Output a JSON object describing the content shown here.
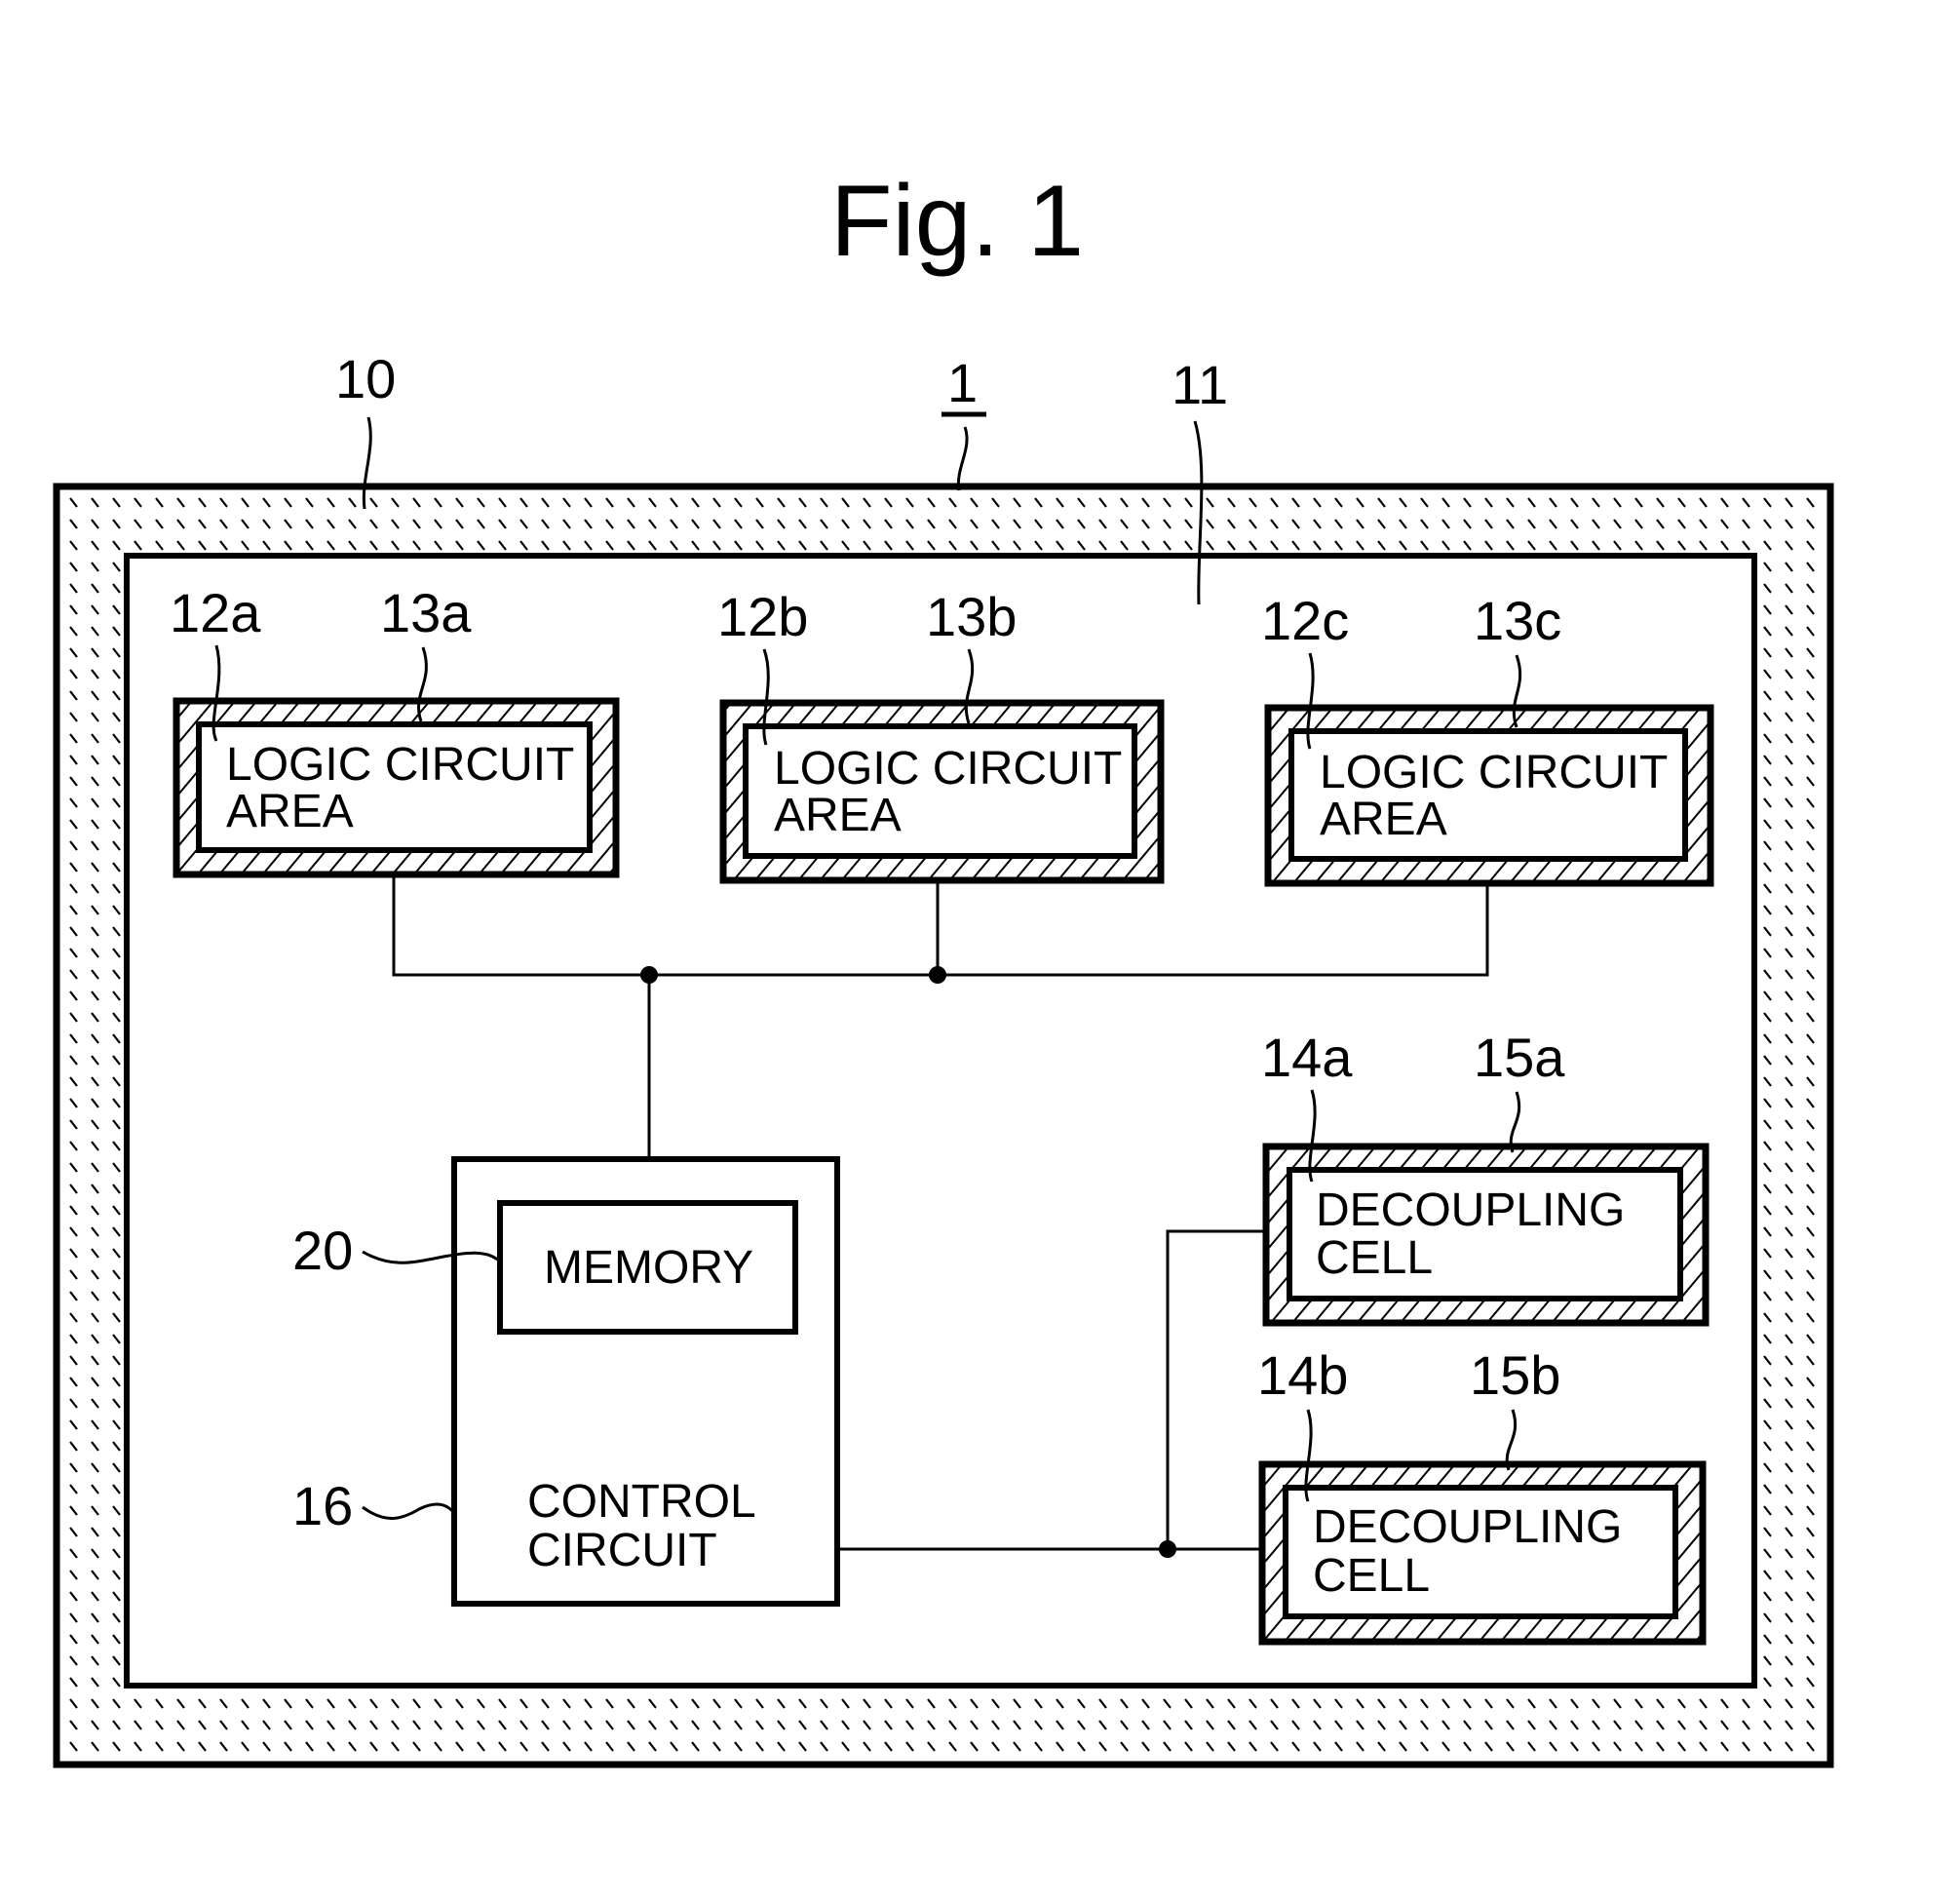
{
  "figure": {
    "title": "Fig. 1",
    "device_ref": "1",
    "chip_ref": "10",
    "core_ref": "11"
  },
  "logic_areas": [
    {
      "area_ref": "12a",
      "ring_ref": "13a",
      "line1": "LOGIC CIRCUIT",
      "line2": "AREA"
    },
    {
      "area_ref": "12b",
      "ring_ref": "13b",
      "line1": "LOGIC CIRCUIT",
      "line2": "AREA"
    },
    {
      "area_ref": "12c",
      "ring_ref": "13c",
      "line1": "LOGIC CIRCUIT",
      "line2": "AREA"
    }
  ],
  "decoupling_cells": [
    {
      "cell_ref": "14a",
      "ring_ref": "15a",
      "line1": "DECOUPLING",
      "line2": "CELL"
    },
    {
      "cell_ref": "14b",
      "ring_ref": "15b",
      "line1": "DECOUPLING",
      "line2": "CELL"
    }
  ],
  "control": {
    "ref": "16",
    "line1": "CONTROL",
    "line2": "CIRCUIT"
  },
  "memory": {
    "ref": "20",
    "label": "MEMORY"
  }
}
